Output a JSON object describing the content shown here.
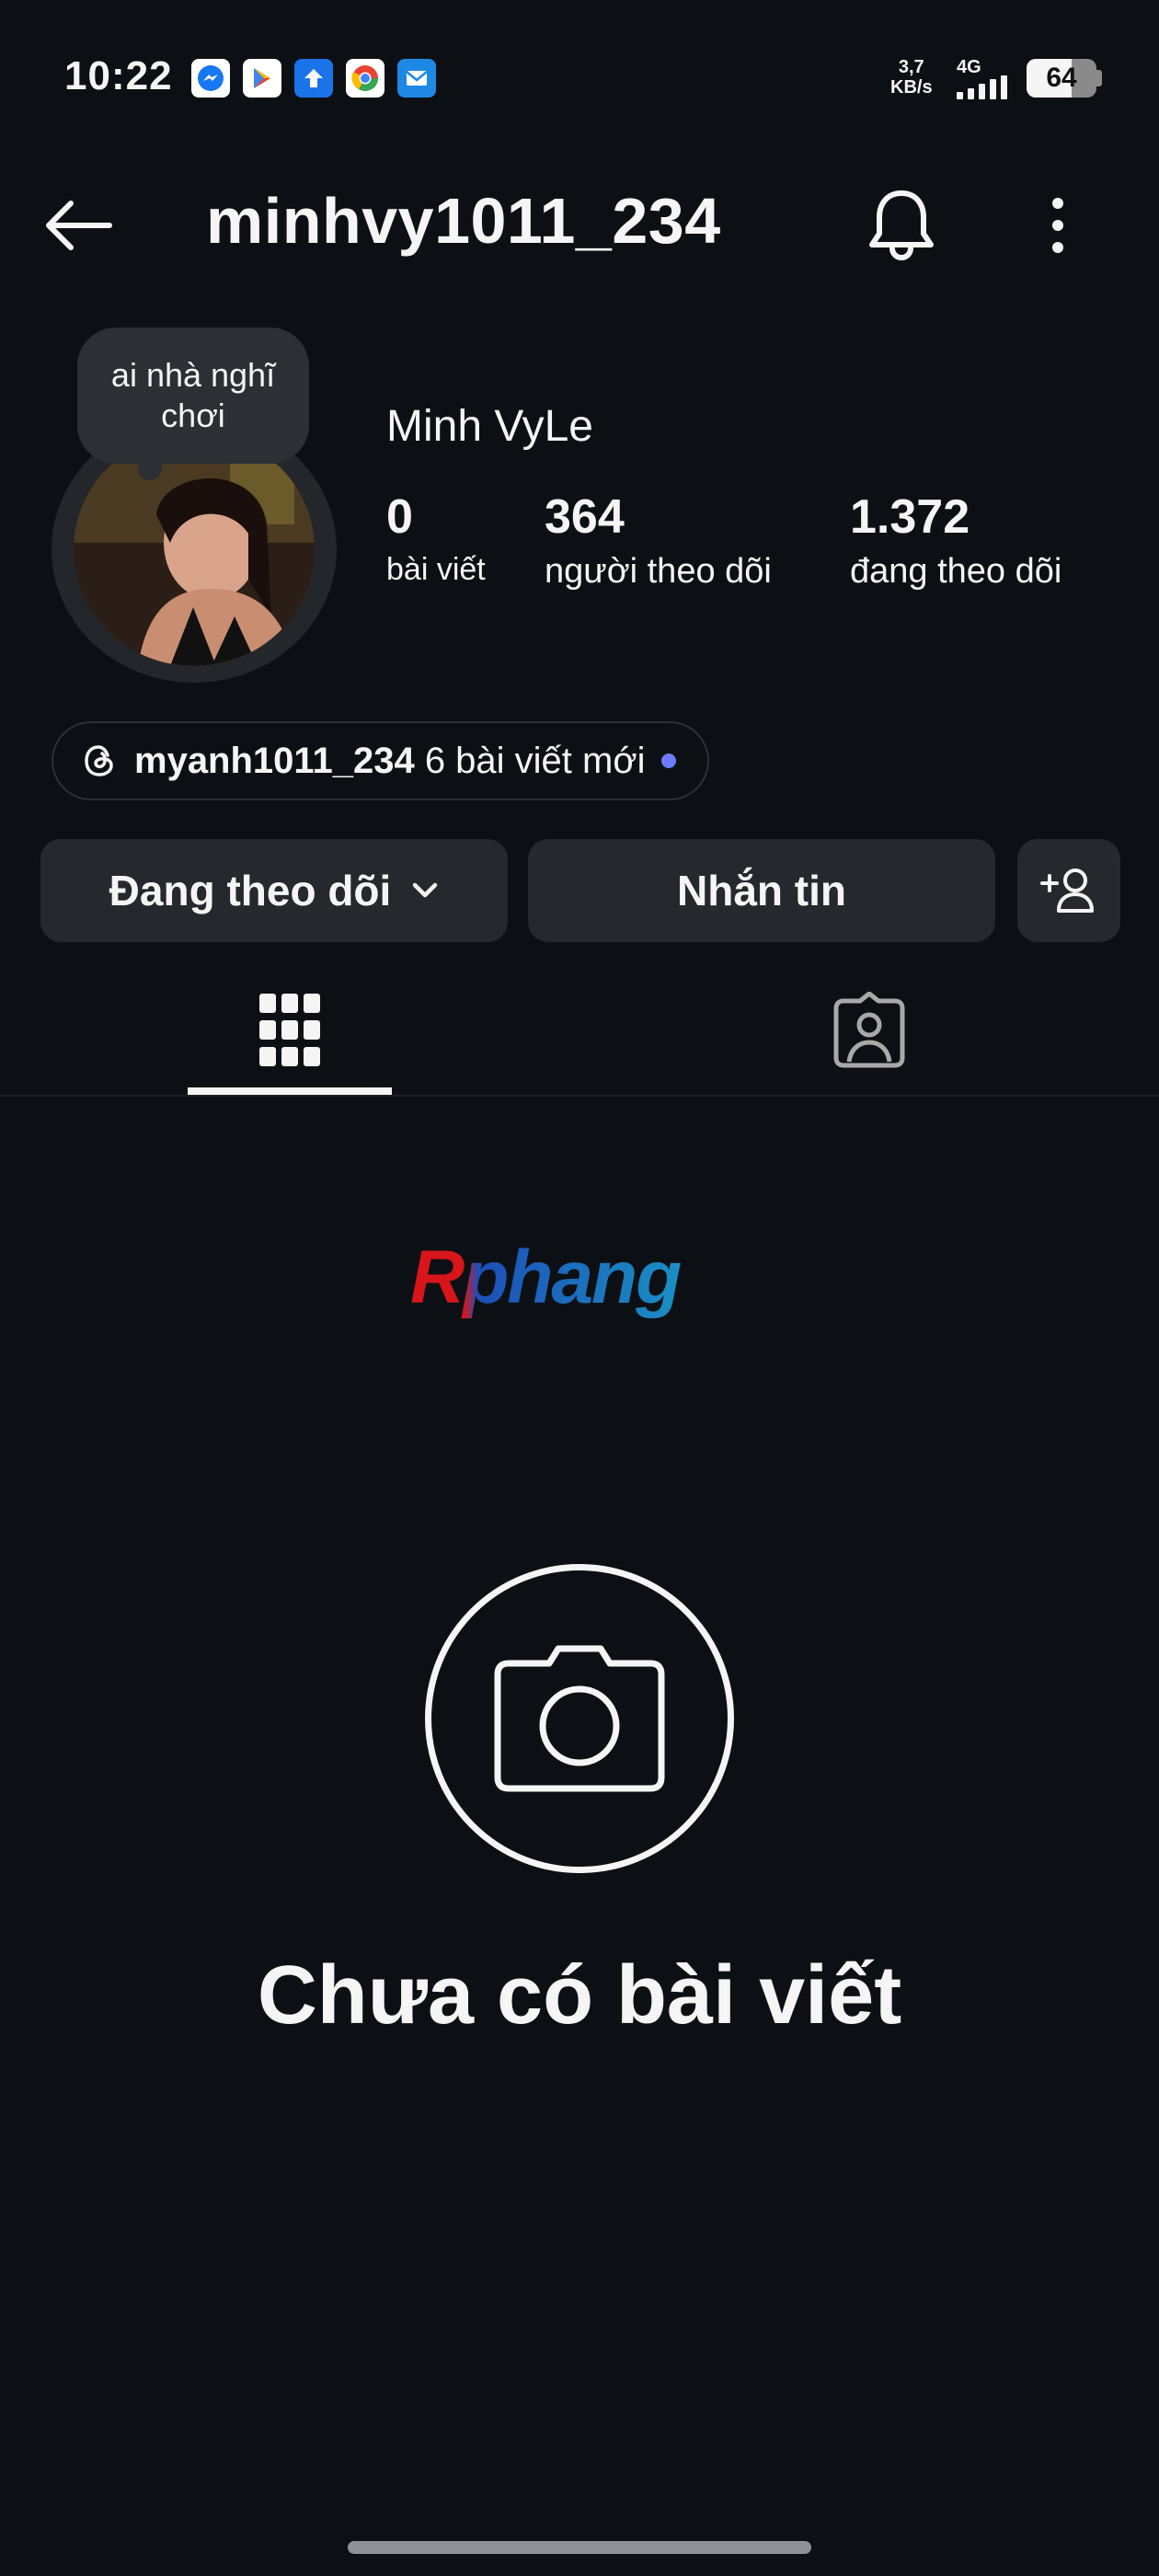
{
  "status_bar": {
    "time": "10:22",
    "notifications": [
      {
        "icon": "messenger-icon",
        "color": "#1877f2",
        "glyph": "✉"
      },
      {
        "icon": "play-store-icon",
        "color": "#ffffff",
        "glyph": "▶"
      },
      {
        "icon": "upload-icon",
        "color": "#1a73e8",
        "glyph": "↑"
      },
      {
        "icon": "chrome-icon",
        "color": "#ea4335",
        "glyph": "◉"
      },
      {
        "icon": "mail-icon",
        "color": "#1e88e5",
        "glyph": "✉"
      }
    ],
    "net_speed_value": "3,7",
    "net_speed_unit": "KB/s",
    "network_type": "4G",
    "battery_level": "64",
    "battery_fraction": 0.64
  },
  "header": {
    "username": "minhvy1011_234"
  },
  "profile": {
    "note": "ai nhà nghĩ chơi",
    "display_name": "Minh VyLe",
    "stats": {
      "posts_count": "0",
      "posts_label": "bài viết",
      "followers_count": "364",
      "followers_label": "người theo dõi",
      "following_count": "1.372",
      "following_label": "đang theo dõi"
    },
    "threads": {
      "username": "myanh1011_234",
      "new_posts": "6 bài viết mới"
    }
  },
  "actions": {
    "following_label": "Đang theo dõi",
    "message_label": "Nhắn tin"
  },
  "watermark": {
    "text": "Rphang"
  },
  "empty_state": {
    "message": "Chưa có bài viết"
  },
  "colors": {
    "background": "#0c1014",
    "button_bg": "#25282d",
    "accent_dot": "#6d7cff"
  }
}
